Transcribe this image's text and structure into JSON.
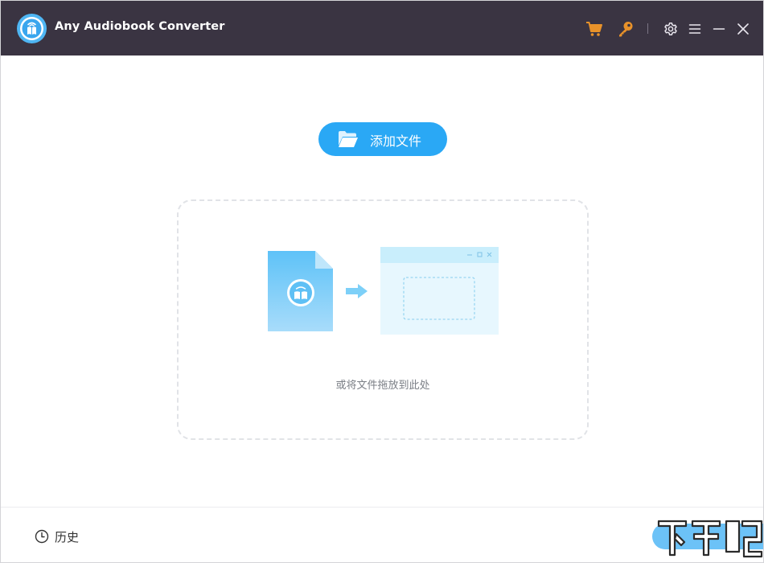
{
  "window": {
    "title": "Any Audiobook Converter"
  },
  "titlebar": {
    "buttons": [
      {
        "name": "cart-icon",
        "label": "cart"
      },
      {
        "name": "key-icon",
        "label": "register"
      },
      {
        "name": "gear-icon",
        "label": "settings"
      },
      {
        "name": "menu-icon",
        "label": "menu"
      },
      {
        "name": "minimize-icon",
        "label": "minimize"
      },
      {
        "name": "close-icon",
        "label": "close"
      }
    ],
    "accent_color": "#e8922a",
    "background_color": "#3a3442"
  },
  "main": {
    "add_file_label": "添加文件",
    "drop_hint": "或将文件拖放到此处",
    "accent_color": "#2aa8f5"
  },
  "footer": {
    "history_label": "历史"
  }
}
